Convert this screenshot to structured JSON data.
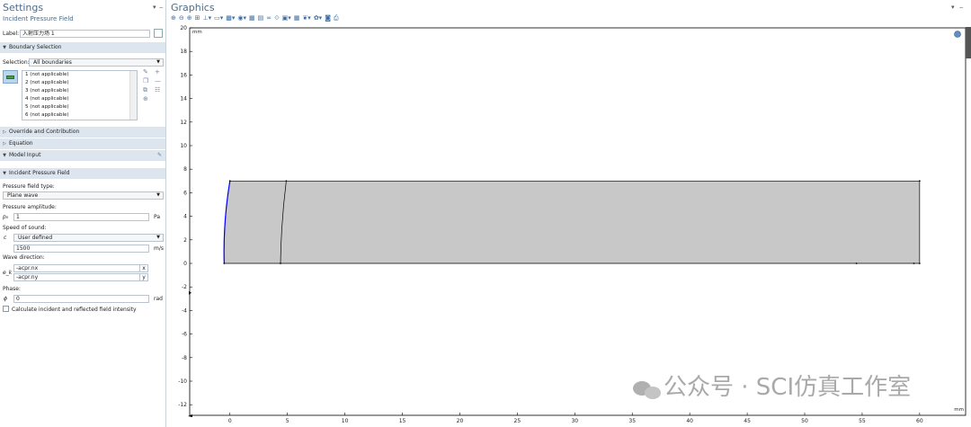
{
  "settings": {
    "title": "Settings",
    "subtitle": "Incident Pressure Field",
    "label_caption": "Label:",
    "label_value": "入射压力场 1",
    "boundary_selection": {
      "header": "Boundary Selection",
      "selection_caption": "Selection:",
      "selection_value": "All boundaries",
      "items": [
        "1 (not applicable)",
        "2 (not applicable)",
        "3 (not applicable)",
        "4 (not applicable)",
        "5 (not applicable)",
        "6 (not applicable)"
      ]
    },
    "override_header": "Override and Contribution",
    "equation_header": "Equation",
    "model_input_header": "Model Input",
    "incident_header": "Incident Pressure Field",
    "pressure_field_type_caption": "Pressure field type:",
    "pressure_field_type_value": "Plane wave",
    "pressure_amplitude_caption": "Pressure amplitude:",
    "pressure_amplitude_symbol": "p₀",
    "pressure_amplitude_value": "1",
    "pressure_amplitude_unit": "Pa",
    "speed_caption": "Speed of sound:",
    "speed_symbol": "c",
    "speed_type_value": "User defined",
    "speed_value": "1500",
    "speed_unit": "m/s",
    "wave_direction_caption": "Wave direction:",
    "wave_symbol": "e_k",
    "wave_x_value": "-acpr.nx",
    "wave_x_unit": "x",
    "wave_y_value": "-acpr.ny",
    "wave_y_unit": "y",
    "phase_caption": "Phase:",
    "phase_symbol": "ϕ",
    "phase_value": "0",
    "phase_unit": "rad",
    "checkbox_label": "Calculate incident and reflected field intensity",
    "checkbox_checked": false
  },
  "graphics": {
    "title": "Graphics",
    "toolbar_icons": [
      "zoom-in-icon",
      "zoom-out-icon",
      "zoom-box-icon",
      "zoom-extents-icon",
      "axis-icon",
      "select-icon",
      "view-icon",
      "camera-icon",
      "grid-icon",
      "wireframe-icon",
      "render-icon",
      "transparency-icon",
      "settings-icon",
      "screenshot-icon",
      "print-icon"
    ],
    "unit_label_top": "mm",
    "unit_label_right": "mm",
    "watermark": "公众号 · SCI仿真工作室"
  },
  "chart_data": {
    "type": "geometry",
    "xlabel": "mm",
    "ylabel": "mm",
    "xlim": [
      -3.5,
      64
    ],
    "ylim": [
      -12.9,
      20
    ],
    "xticks": [
      0,
      5,
      10,
      15,
      20,
      25,
      30,
      35,
      40,
      45,
      50,
      55,
      60
    ],
    "yticks": [
      20,
      18,
      16,
      14,
      12,
      10,
      8,
      6,
      4,
      2,
      0,
      -2,
      -4,
      -6,
      -8,
      -10,
      -12
    ],
    "geometry": {
      "outer_rect": {
        "x0": 0,
        "x1": 60,
        "y0": 0,
        "y1": 7
      },
      "left_curve": {
        "bottom": [
          -0.5,
          0
        ],
        "top": [
          0,
          7
        ],
        "color": "#0000ff"
      },
      "inner_curve": {
        "bottom": [
          4.4,
          0
        ],
        "top": [
          4.9,
          7
        ]
      },
      "fill": "#c8c8c8"
    },
    "grid": false
  }
}
